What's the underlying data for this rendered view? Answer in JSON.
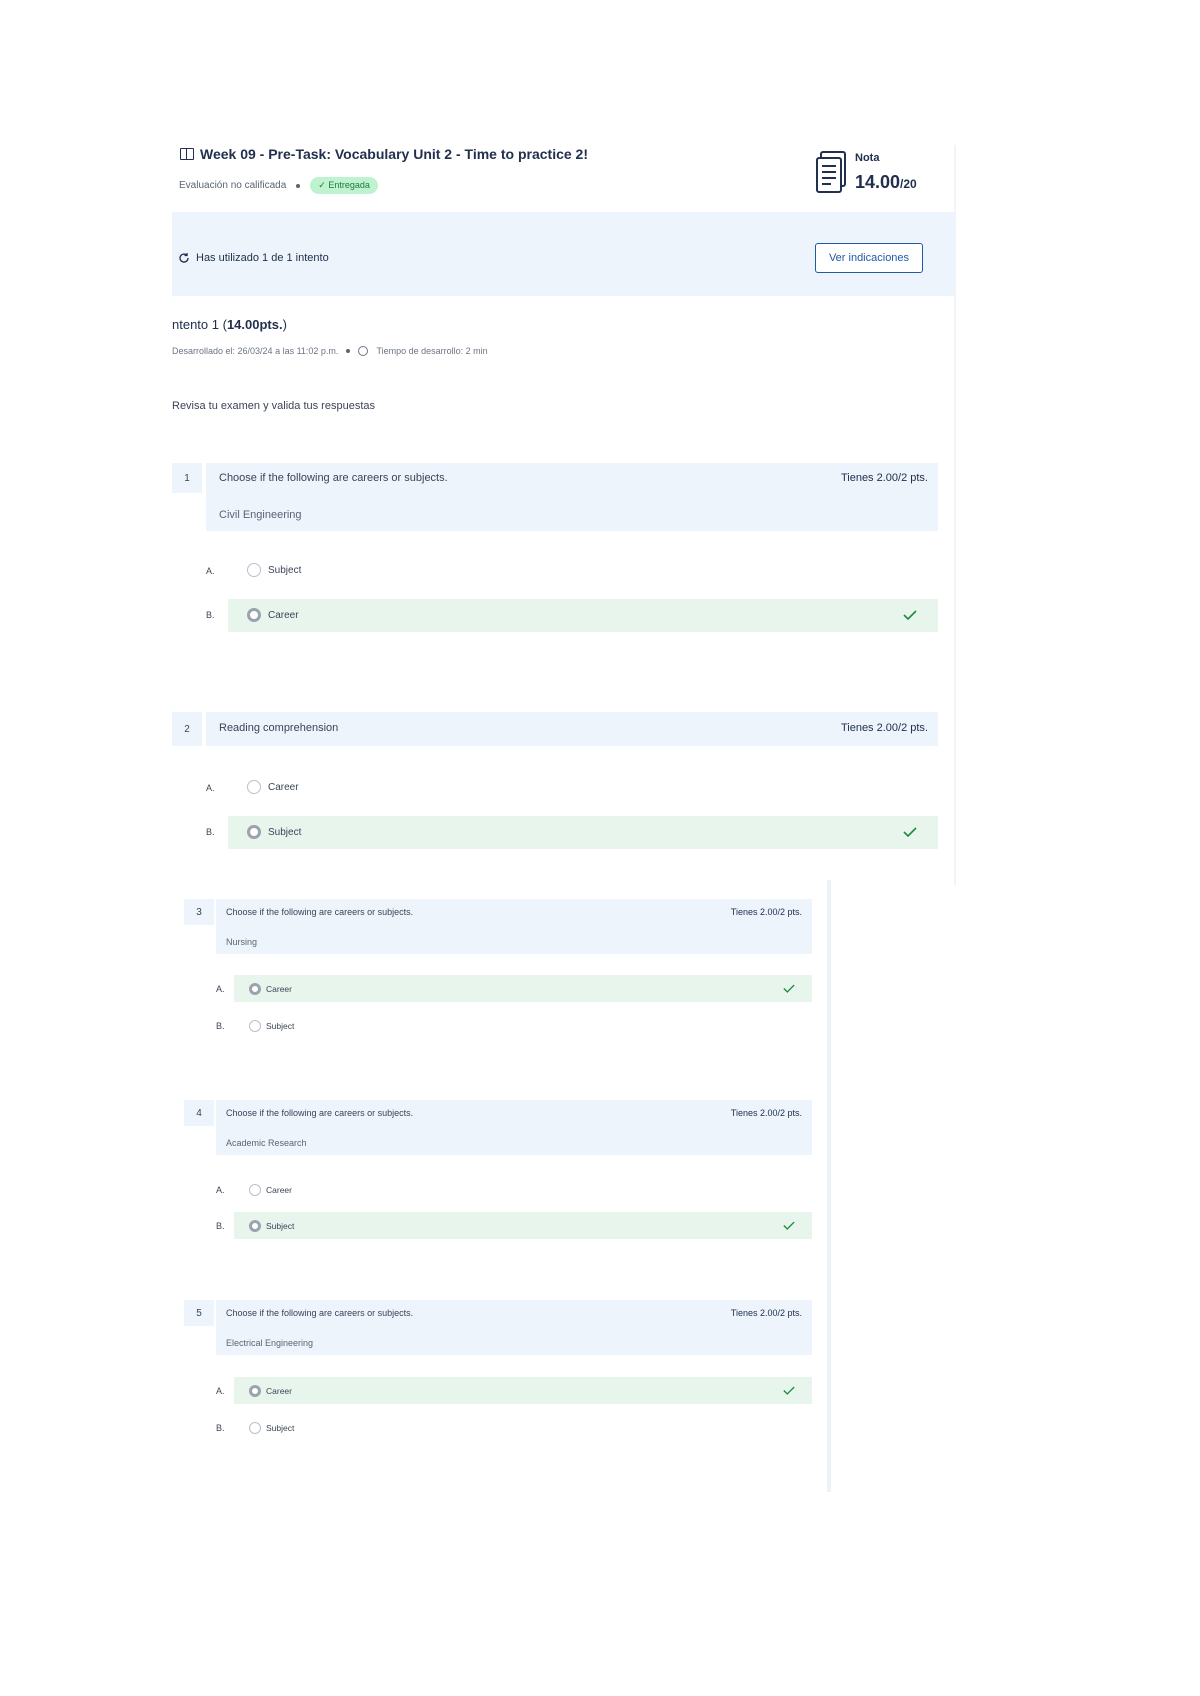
{
  "header": {
    "title": "Week 09 - Pre-Task: Vocabulary Unit 2 - Time to practice 2!",
    "evaluation": "Evaluación no calificada",
    "status_badge": "✓ Entregada",
    "nota_label": "Nota",
    "nota_value": "14.00",
    "nota_total": "/20"
  },
  "attempt_bar": {
    "text": "Has utilizado 1 de 1 intento",
    "button_label": "Ver indicaciones"
  },
  "attempt": {
    "title_prefix": "ntento 1 (",
    "score": "14.00pts.",
    "title_suffix": ")",
    "developed": "Desarrollado el: 26/03/24 a las 11:02 p.m.",
    "duration": "Tiempo de desarrollo: 2 min"
  },
  "review_text": "Revisa tu examen y valida tus respuestas",
  "questions": [
    {
      "number": "1",
      "text": "Choose if the following are careers or subjects.",
      "subtitle": "Civil Engineering",
      "points": "Tienes 2.00/2 pts.",
      "options": [
        {
          "letter": "A.",
          "label": "Subject"
        },
        {
          "letter": "B.",
          "label": "Career"
        }
      ]
    },
    {
      "number": "2",
      "text": "Reading comprehension",
      "subtitle": "",
      "points": "Tienes 2.00/2 pts.",
      "options": [
        {
          "letter": "A.",
          "label": "Career"
        },
        {
          "letter": "B.",
          "label": "Subject"
        }
      ]
    },
    {
      "number": "3",
      "text": "Choose if the following are careers or subjects.",
      "subtitle": "Nursing",
      "points": "Tienes 2.00/2 pts.",
      "options": [
        {
          "letter": "A.",
          "label": "Career"
        },
        {
          "letter": "B.",
          "label": "Subject"
        }
      ]
    },
    {
      "number": "4",
      "text": "Choose if the following are careers or subjects.",
      "subtitle": "Academic Research",
      "points": "Tienes 2.00/2 pts.",
      "options": [
        {
          "letter": "A.",
          "label": "Career"
        },
        {
          "letter": "B.",
          "label": "Subject"
        }
      ]
    },
    {
      "number": "5",
      "text": "Choose if the following are careers or subjects.",
      "subtitle": "Electrical Engineering",
      "points": "Tienes 2.00/2 pts.",
      "options": [
        {
          "letter": "A.",
          "label": "Career"
        },
        {
          "letter": "B.",
          "label": "Subject"
        }
      ]
    }
  ],
  "colors": {
    "accent": "#1e5aa8",
    "correct": "#1d8a3e",
    "panel": "#edf4fc",
    "correct_bg": "#e8f5ec"
  }
}
